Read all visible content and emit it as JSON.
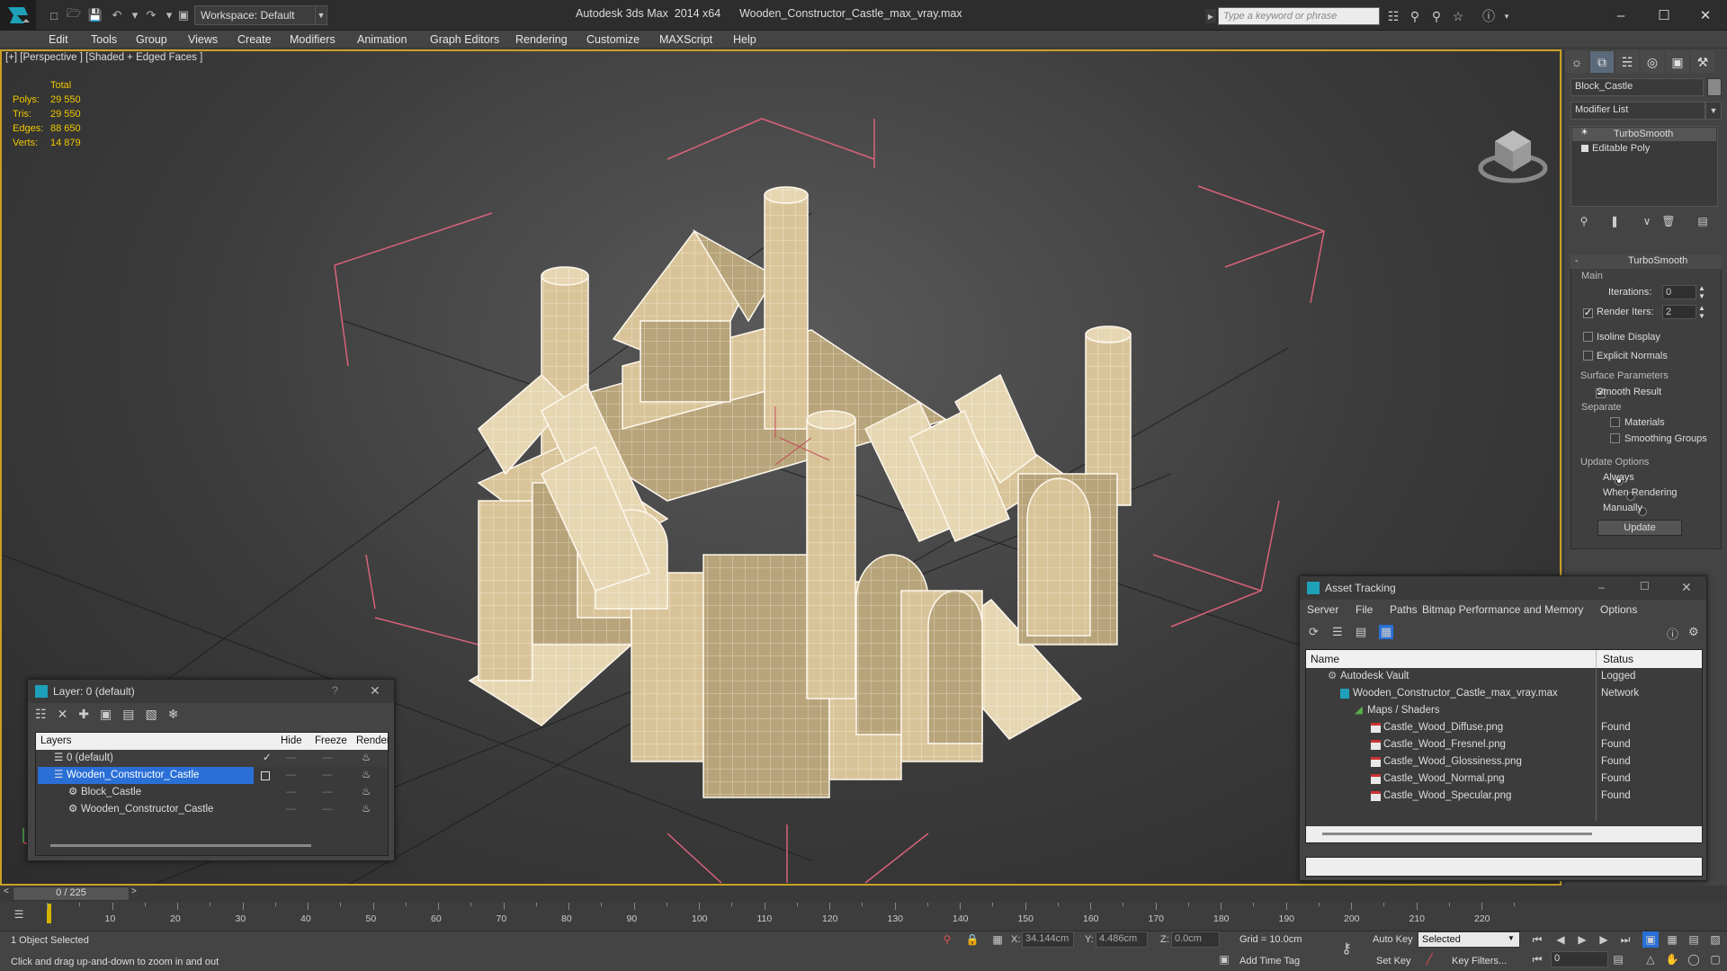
{
  "titlebar": {
    "workspace_label": "Workspace: Default",
    "app_name": "Autodesk 3ds Max  2014 x64",
    "file_name": "Wooden_Constructor_Castle_max_vray.max",
    "search_placeholder": "Type a keyword or phrase"
  },
  "menu": [
    "Edit",
    "Tools",
    "Group",
    "Views",
    "Create",
    "Modifiers",
    "Animation",
    "Graph Editors",
    "Rendering",
    "Customize",
    "MAXScript",
    "Help"
  ],
  "viewport": {
    "label": "[+] [Perspective ] [Shaded + Edged Faces ]",
    "stats": {
      "header": "Total",
      "polys_label": "Polys:",
      "polys": "29 550",
      "tris_label": "Tris:",
      "tris": "29 550",
      "edges_label": "Edges:",
      "edges": "88 650",
      "verts_label": "Verts:",
      "verts": "14 879"
    }
  },
  "command_panel": {
    "object_name": "Block_Castle",
    "modifier_list": "Modifier List",
    "stack": [
      "TurboSmooth",
      "Editable Poly"
    ],
    "turbosmooth": {
      "title": "TurboSmooth",
      "main_label": "Main",
      "iterations_label": "Iterations:",
      "iterations": "0",
      "render_iters_label": "Render Iters:",
      "render_iters": "2",
      "isoline": "Isoline Display",
      "explicit_normals": "Explicit Normals",
      "surface_params": "Surface Parameters",
      "smooth_result": "Smooth Result",
      "separate": "Separate",
      "materials": "Materials",
      "smoothing_groups": "Smoothing Groups",
      "update_options": "Update Options",
      "always": "Always",
      "when_rendering": "When Rendering",
      "manually": "Manually",
      "update_btn": "Update"
    }
  },
  "layer_dialog": {
    "title": "Layer: 0 (default)",
    "columns": {
      "layers": "Layers",
      "hide": "Hide",
      "freeze": "Freeze",
      "render": "Render"
    },
    "rows": [
      "0 (default)",
      "Wooden_Constructor_Castle",
      "Block_Castle",
      "Wooden_Constructor_Castle"
    ]
  },
  "asset_tracking": {
    "title": "Asset Tracking",
    "menu": [
      "Server",
      "File",
      "Paths",
      "Bitmap Performance and Memory",
      "Options"
    ],
    "columns": {
      "name": "Name",
      "status": "Status"
    },
    "rows": [
      {
        "name": "Autodesk Vault",
        "status": "Logged"
      },
      {
        "name": "Wooden_Constructor_Castle_max_vray.max",
        "status": "Network"
      },
      {
        "name": "Maps / Shaders",
        "status": ""
      },
      {
        "name": "Castle_Wood_Diffuse.png",
        "status": "Found"
      },
      {
        "name": "Castle_Wood_Fresnel.png",
        "status": "Found"
      },
      {
        "name": "Castle_Wood_Glossiness.png",
        "status": "Found"
      },
      {
        "name": "Castle_Wood_Normal.png",
        "status": "Found"
      },
      {
        "name": "Castle_Wood_Specular.png",
        "status": "Found"
      }
    ]
  },
  "timeline": {
    "frame": "0 / 225",
    "ticks": [
      "10",
      "20",
      "30",
      "40",
      "50",
      "60",
      "70",
      "80",
      "90",
      "100",
      "110",
      "120",
      "130",
      "140",
      "150",
      "160",
      "170",
      "180",
      "190",
      "200",
      "210",
      "220"
    ]
  },
  "status": {
    "selected": "1 Object Selected",
    "prompt": "Click and drag up-and-down to zoom in and out",
    "x_label": "X:",
    "x": "34.144cm",
    "y_label": "Y:",
    "y": "4.486cm",
    "z_label": "Z:",
    "z": "0.0cm",
    "grid": "Grid = 10.0cm",
    "add_time_tag": "Add Time Tag",
    "auto_key": "Auto Key",
    "set_key": "Set Key",
    "selected_dropdown": "Selected",
    "key_filters": "Key Filters...",
    "frame_field": "0"
  },
  "colors": {
    "accent_yellow": "#f0c800",
    "viewport_border": "#c9a024",
    "selection_blue": "#2a6fd6",
    "wood": "#d9c49a"
  }
}
